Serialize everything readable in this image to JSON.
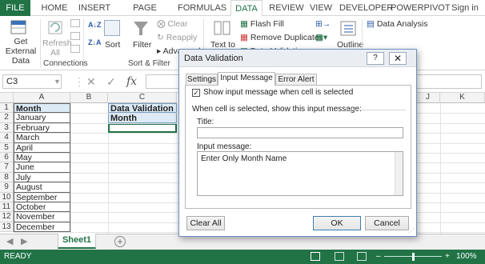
{
  "ribbon_tabs": [
    "FILE",
    "HOME",
    "INSERT",
    "PAGE LAYOUT",
    "FORMULAS",
    "DATA",
    "REVIEW",
    "VIEW",
    "DEVELOPER",
    "POWERPIVOT",
    "Sign in"
  ],
  "active_tab": "DATA",
  "ribbon": {
    "get_external_data": "Get External Data",
    "refresh_all": "Refresh All",
    "connections_label": "Connections",
    "sort_asc": "A↓Z",
    "sort_desc": "Z↓A",
    "sort": "Sort",
    "filter": "Filter",
    "clear": "Clear",
    "reapply": "Reapply",
    "advanced": "Advanced",
    "sort_filter_label": "Sort & Filter",
    "text_to_columns": "Text to",
    "flash_fill": "Flash Fill",
    "remove_duplicates": "Remove Duplicates",
    "data_validation_partial": "Data Validation",
    "outline": "Outline",
    "data_analysis": "Data Analysis"
  },
  "formula_bar": {
    "name_box": "C3",
    "fx": "fx",
    "value": ""
  },
  "grid": {
    "columns": [
      "A",
      "B",
      "C",
      "J",
      "K"
    ],
    "rows": [
      1,
      2,
      3,
      4,
      5,
      6,
      7,
      8,
      9,
      10,
      11,
      12,
      13
    ],
    "column_a": [
      "Month",
      "January",
      "February",
      "March",
      "April",
      "May",
      "June",
      "July",
      "August",
      "September",
      "October",
      "November",
      "December"
    ],
    "c1": "Data Validation",
    "c2": "Month"
  },
  "sheets": [
    "Sheet1"
  ],
  "status": {
    "ready": "READY",
    "zoom": "100%",
    "zoom_fraction": 1.0
  },
  "dialog": {
    "title": "Data Validation",
    "help": "?",
    "tabs": [
      "Settings",
      "Input Message",
      "Error Alert"
    ],
    "active_tab": "Input Message",
    "show_checkbox_label": "Show input message when cell is selected",
    "show_checked": true,
    "group_label": "When cell is selected, show this input message:",
    "title_label": "Title:",
    "title_value": "",
    "message_label": "Input message:",
    "message_value": "Enter Only Month Name",
    "clear_all": "Clear All",
    "ok": "OK",
    "cancel": "Cancel"
  },
  "colors": {
    "excel_green": "#217346",
    "header_fill": "#ddebf7"
  }
}
